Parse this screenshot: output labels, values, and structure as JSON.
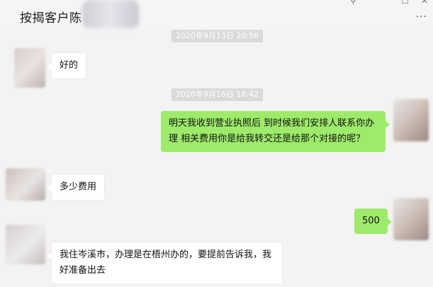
{
  "header": {
    "title": "按揭客户陈",
    "pin_icon": "pin-icon",
    "minimize_icon": "minimize-icon",
    "close_icon": "close-icon",
    "more_icon": "more-icon",
    "more_label": "···"
  },
  "messages": [
    {
      "kind": "timestamp",
      "text": "2020年9月13日 20:56"
    },
    {
      "kind": "message",
      "side": "left",
      "text": "好的"
    },
    {
      "kind": "timestamp",
      "text": "2020年9月16日 16:42"
    },
    {
      "kind": "message",
      "side": "right",
      "text": "明天我收到营业执照后 到时候我们安排人联系你办理 相关费用你是给我转交还是给那个对接的呢？"
    },
    {
      "kind": "message",
      "side": "left",
      "text": "多少费用"
    },
    {
      "kind": "message",
      "side": "right",
      "text": "500"
    },
    {
      "kind": "message",
      "side": "left",
      "text": "我住岑溪市，办理是在梧州办的，要提前告诉我，我好准备出去"
    }
  ],
  "colors": {
    "background": "#f3f3f3",
    "incoming_bubble": "#ffffff",
    "outgoing_bubble": "#9eea6a",
    "timestamp_bg": "#dadada"
  }
}
